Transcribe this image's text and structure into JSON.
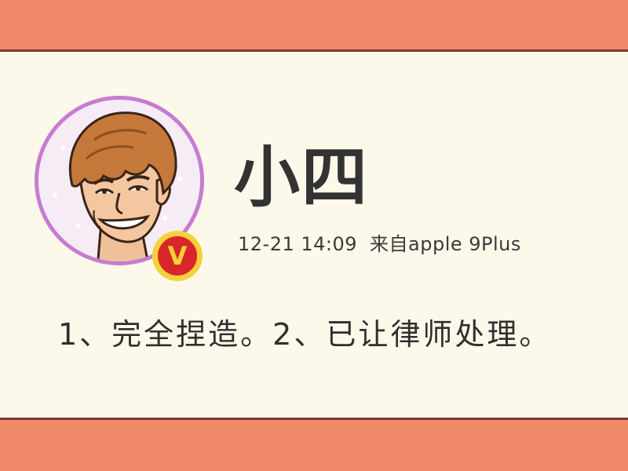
{
  "post": {
    "username": "小四",
    "timestamp": "12-21 14:09",
    "source": "来自apple 9Plus",
    "text": "1、完全捏造。2、已让律师处理。"
  },
  "badge": {
    "letter": "V",
    "icon": "verified-v-badge"
  },
  "avatar": {
    "icon": "cartoon-avatar"
  },
  "colors": {
    "band": "#f08a69",
    "band_line": "#7a3a28",
    "card": "#fcf8ea",
    "avatar_ring": "#c77ccf",
    "badge_fill": "#d9262a",
    "badge_ring": "#f4d23a"
  }
}
